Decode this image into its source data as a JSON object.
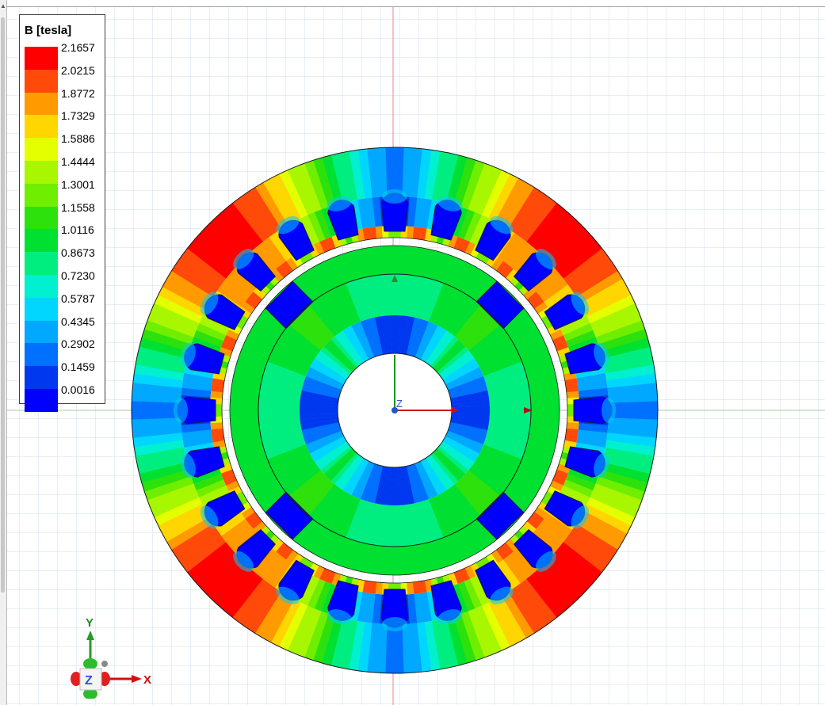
{
  "legend": {
    "title": "B [tesla]",
    "values": [
      "2.1657",
      "2.0215",
      "1.8772",
      "1.7329",
      "1.5886",
      "1.4444",
      "1.3001",
      "1.1558",
      "1.0116",
      "0.8673",
      "0.7230",
      "0.5787",
      "0.4345",
      "0.2902",
      "0.1459",
      "0.0016"
    ],
    "colors": [
      "#ff0000",
      "#ff4a0a",
      "#ff9a00",
      "#ffd600",
      "#e4ff00",
      "#a8f600",
      "#6fee00",
      "#2ce10c",
      "#00e030",
      "#00ee80",
      "#00f0d0",
      "#00d6ff",
      "#00a8ff",
      "#0070ff",
      "#0038f0",
      "#0000ff"
    ]
  },
  "field_plot": {
    "quantity": "B",
    "unit": "tesla",
    "stator_slots": 24,
    "rotor_poles": 4
  },
  "triad": {
    "x_label": "X",
    "y_label": "Y",
    "z_label": "Z"
  },
  "origin_axes": {
    "z_label": "Z"
  },
  "colors": {
    "grid": "#c7d4e4",
    "crosshair_red": "#d08080",
    "crosshair_green": "#80c080",
    "background": "#ffffff"
  }
}
